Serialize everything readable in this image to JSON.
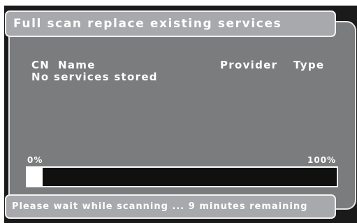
{
  "title": "Full scan replace existing services",
  "list": {
    "columns": {
      "cn": "CN",
      "name": "Name",
      "provider": "Provider",
      "type": "Type"
    },
    "empty_message": "No services stored"
  },
  "progress": {
    "start_label": "0%",
    "end_label": "100%",
    "value_fraction": 0.05
  },
  "status": "Please wait while scanning ... 9 minutes remaining",
  "colors": {
    "screen_bg": "#1a1a1a",
    "panel_bg": "#7b7c7e",
    "bar_bg": "#a8a9ac",
    "text": "#ffffff"
  }
}
